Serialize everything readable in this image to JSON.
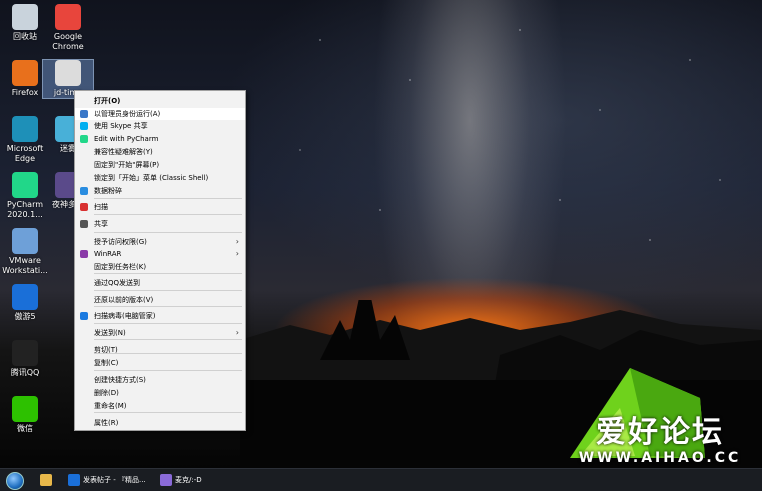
{
  "desktop": {
    "icons": [
      {
        "label": "回收站",
        "icon": "recycle-bin-icon",
        "color": "#c9d3dc"
      },
      {
        "label": "Google\nChrome",
        "icon": "chrome-icon",
        "color": "#e8453c"
      },
      {
        "label": "Firefox",
        "icon": "firefox-icon",
        "color": "#e8701c"
      },
      {
        "label": "jd-time",
        "icon": "clock-icon",
        "color": "#dcdcdc"
      },
      {
        "label": "Microsoft\nEdge",
        "icon": "edge-icon",
        "color": "#1e90b8"
      },
      {
        "label": "迷雾",
        "icon": "app-icon",
        "color": "#48b0d8"
      },
      {
        "label": "PyCharm\n2020.1...",
        "icon": "pycharm-icon",
        "color": "#21d789"
      },
      {
        "label": "夜神多开",
        "icon": "nox-icon",
        "color": "#5a4a8a"
      },
      {
        "label": "VMware\nWorkstati...",
        "icon": "vmware-icon",
        "color": "#6ea0d8"
      },
      {
        "label": "傲游5",
        "icon": "maxthon-icon",
        "color": "#1a6fd8"
      },
      {
        "label": "腾讯QQ",
        "icon": "qq-icon",
        "color": "#222222"
      },
      {
        "label": "微信",
        "icon": "wechat-icon",
        "color": "#2dc100"
      }
    ]
  },
  "context_menu": {
    "items": [
      {
        "label": "打开(O)",
        "bold": true
      },
      {
        "label": "以管理员身份运行(A)",
        "icon": "shield-icon",
        "color": "#3a78c8",
        "hover": true
      },
      {
        "label": "使用 Skype 共享",
        "icon": "skype-icon",
        "color": "#00aff0"
      },
      {
        "label": "Edit with PyCharm",
        "icon": "pycharm-icon",
        "color": "#21d789"
      },
      {
        "label": "兼容性疑难解答(Y)"
      },
      {
        "label": "固定到\"开始\"屏幕(P)"
      },
      {
        "label": "锁定到「开始」菜单 (Classic Shell)"
      },
      {
        "label": "数据粉碎",
        "icon": "shredder-icon",
        "color": "#2a8de0"
      },
      {
        "label": "扫描",
        "icon": "scan-icon",
        "color": "#d83030"
      },
      {
        "label": "共享",
        "icon": "share-icon",
        "color": "#555555"
      },
      {
        "label": "授予访问权限(G)",
        "submenu": true
      },
      {
        "label": "WinRAR",
        "icon": "winrar-icon",
        "color": "#8a3aa8",
        "submenu": true
      },
      {
        "label": "固定到任务栏(K)"
      },
      {
        "label": "通过QQ发送到"
      },
      {
        "label": "还原以前的版本(V)"
      },
      {
        "label": "扫描病毒(电脑管家)",
        "icon": "tencent-guard-icon",
        "color": "#1a7ae0"
      },
      {
        "label": "发送到(N)",
        "submenu": true
      },
      {
        "label": "剪切(T)"
      },
      {
        "label": "复制(C)"
      },
      {
        "label": "创建快捷方式(S)"
      },
      {
        "label": "删除(D)"
      },
      {
        "label": "重命名(M)"
      },
      {
        "label": "属性(R)"
      }
    ]
  },
  "taskbar": {
    "items": [
      {
        "label": "",
        "icon": "file-explorer-icon",
        "color": "#e8b84a"
      },
      {
        "label": "发表帖子 - 『精品...",
        "icon": "maxthon-icon",
        "color": "#1a6fd8"
      },
      {
        "label": "麦克/:-D",
        "icon": "avatar-icon",
        "color": "#8a6ad8"
      }
    ]
  },
  "watermark": {
    "title": "爱好论坛",
    "url": "WWW.AIHAO.CC"
  }
}
